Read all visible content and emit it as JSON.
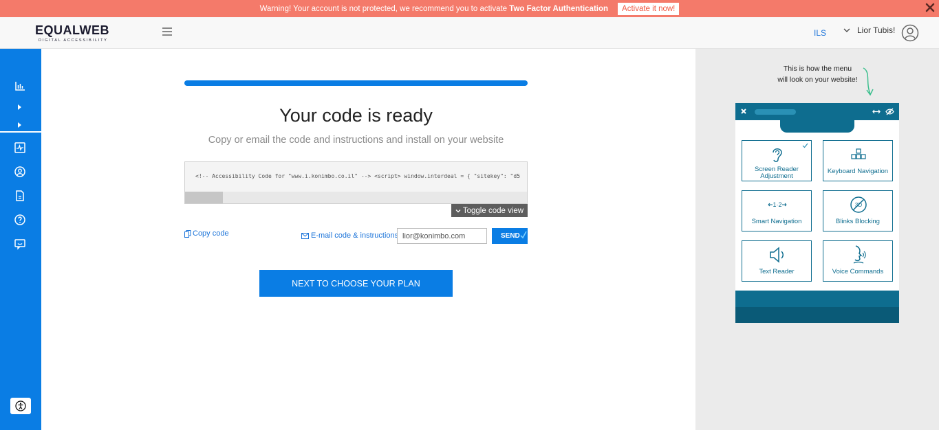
{
  "banner": {
    "message_prefix": "Warning! Your account is not protected, we recommend you to activate ",
    "message_bold": "Two Factor Authentication",
    "activate_label": "Activate it now!"
  },
  "header": {
    "logo_word": "EQUALWEB",
    "logo_tagline": "DIGITAL ACCESSIBILITY",
    "currency": "ILS",
    "user_greeting": "Lior Tubis!"
  },
  "main": {
    "title": "Your code is ready",
    "subtitle": "Copy or email the code and instructions and install on your website",
    "code_snippet": "<!-- Accessibility Code for \"www.i.konimbo.co.il\" --> <script> window.interdeal = { \"sitekey\": \"d5",
    "toggle_label": "Toggle code view",
    "copy_label": "Copy code",
    "email_label": "E-mail code & instructions",
    "email_value": "lior@konimbo.com",
    "send_label": "SEND",
    "next_label": "NEXT TO CHOOSE YOUR PLAN"
  },
  "preview": {
    "note_line1": "This is how the menu",
    "note_line2": "will look on your website!",
    "tiles": [
      {
        "label": "Screen Reader Adjustment",
        "icon": "ear-icon",
        "checked": true
      },
      {
        "label": "Keyboard Navigation",
        "icon": "keyboard-icon",
        "checked": false
      },
      {
        "label": "Smart Navigation",
        "icon": "smart-nav-icon",
        "checked": false
      },
      {
        "label": "Blinks Blocking",
        "icon": "blinks-blocking-icon",
        "checked": false
      },
      {
        "label": "Text Reader",
        "icon": "speaker-icon",
        "checked": false
      },
      {
        "label": "Voice Commands",
        "icon": "voice-icon",
        "checked": false
      }
    ]
  },
  "colors": {
    "primary": "#0a7de4",
    "banner": "#f47a6a",
    "widget": "#0e6d8f"
  }
}
